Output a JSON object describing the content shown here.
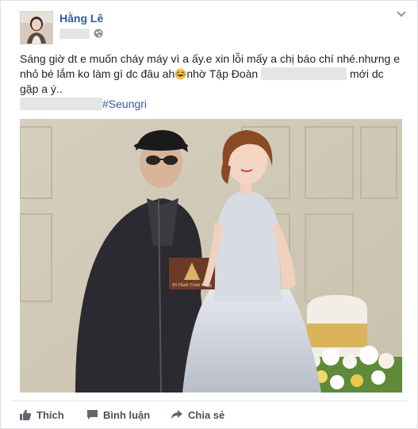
{
  "post": {
    "author": "Hằng Lê",
    "text_line1": "Sáng giờ dt e muốn cháy máy vì a ấy.e xin lỗi mấy a chị báo chí nhé.nhưng e",
    "text_line2a": "nhỏ bé lắm ko làm gì dc đâu ah",
    "text_line2b": "nhờ Tập Đoàn",
    "text_line2c": "mới dc",
    "text_line3": "gặp a ý..",
    "hashtag": "#Seungri",
    "photo": {
      "sign_text": "Đi Hành Trình Cùng"
    }
  },
  "actions": {
    "like": "Thích",
    "comment": "Bình luận",
    "share": "Chia sẻ"
  },
  "icons": {
    "privacy": "globe-icon",
    "menu": "chevron-down-icon",
    "emoji": "laughing-emoji-icon",
    "like": "thumbs-up-icon",
    "comment": "comment-icon",
    "share": "share-arrow-icon"
  },
  "colors": {
    "link": "#365899",
    "text": "#1d2129",
    "action_text": "#4b4f56",
    "background": "#e9ebee"
  }
}
